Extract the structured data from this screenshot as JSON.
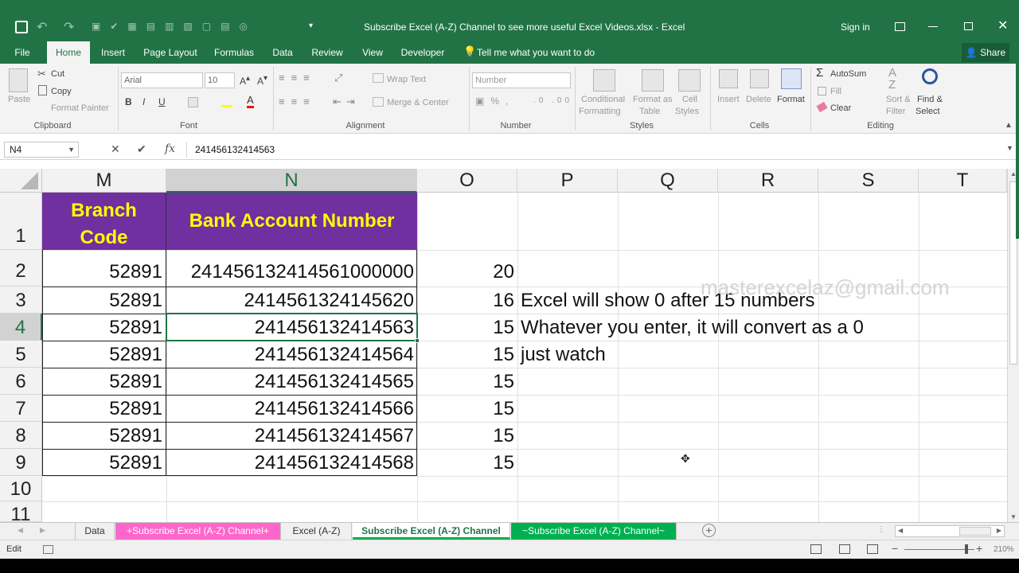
{
  "window": {
    "title": "Subscribe Excel (A-Z) Channel to see more useful Excel Videos.xlsx  -  Excel",
    "sign_in": "Sign in"
  },
  "tabs": [
    "File",
    "Home",
    "Insert",
    "Page Layout",
    "Formulas",
    "Data",
    "Review",
    "View",
    "Developer"
  ],
  "tell_me": "Tell me what you want to do",
  "share": "Share",
  "ribbon": {
    "clipboard": {
      "paste": "Paste",
      "cut": "Cut",
      "copy": "Copy",
      "format_painter": "Format Painter",
      "label": "Clipboard"
    },
    "font": {
      "name": "Arial",
      "size": "10",
      "label": "Font"
    },
    "alignment": {
      "wrap": "Wrap Text",
      "merge": "Merge & Center",
      "label": "Alignment"
    },
    "number": {
      "format": "Number",
      "label": "Number"
    },
    "styles": {
      "conditional1": "Conditional",
      "conditional2": "Formatting",
      "format_as1": "Format as",
      "format_as2": "Table",
      "cell1": "Cell",
      "cell2": "Styles",
      "label": "Styles"
    },
    "cells": {
      "insert": "Insert",
      "delete": "Delete",
      "format": "Format",
      "label": "Cells"
    },
    "editing": {
      "autosum": "AutoSum",
      "fill": "Fill",
      "clear": "Clear",
      "sort1": "Sort &",
      "sort2": "Filter",
      "find1": "Find &",
      "find2": "Select",
      "label": "Editing"
    }
  },
  "formula_bar": {
    "name_box": "N4",
    "value": "241456132414563"
  },
  "columns": [
    "M",
    "N",
    "O",
    "P",
    "Q",
    "R",
    "S",
    "T"
  ],
  "rows": [
    "1",
    "2",
    "3",
    "4",
    "5",
    "6",
    "7",
    "8",
    "9",
    "10",
    "11"
  ],
  "header": {
    "branch1": "Branch",
    "branch2": "Code",
    "account": "Bank Account Number"
  },
  "data_rows": [
    {
      "branch": "52891",
      "account": "241456132414561000000",
      "len": "20",
      "note": ""
    },
    {
      "branch": "52891",
      "account": "2414561324145620",
      "len": "16",
      "note": "Excel will show 0 after 15 numbers"
    },
    {
      "branch": "52891",
      "account": "241456132414563",
      "len": "15",
      "note": "Whatever you enter, it will convert as a 0"
    },
    {
      "branch": "52891",
      "account": "241456132414564",
      "len": "15",
      "note": "just watch"
    },
    {
      "branch": "52891",
      "account": "241456132414565",
      "len": "15",
      "note": ""
    },
    {
      "branch": "52891",
      "account": "241456132414566",
      "len": "15",
      "note": ""
    },
    {
      "branch": "52891",
      "account": "241456132414567",
      "len": "15",
      "note": ""
    },
    {
      "branch": "52891",
      "account": "241456132414568",
      "len": "15",
      "note": ""
    }
  ],
  "watermark": "masterexcelaz@gmail.com",
  "sheet_tabs": [
    "Data",
    "+Subscribe Excel (A-Z) Channel+",
    "Excel (A-Z)",
    "Subscribe Excel (A-Z) Channel",
    "~Subscribe Excel (A-Z) Channel~"
  ],
  "status": {
    "mode": "Edit",
    "zoom": "210%"
  },
  "colors": {
    "excel_green": "#217346",
    "header_purple": "#7030a0",
    "header_yellow": "#ffff00",
    "pink_tab": "#ff66cc",
    "green_tab": "#00b050"
  }
}
